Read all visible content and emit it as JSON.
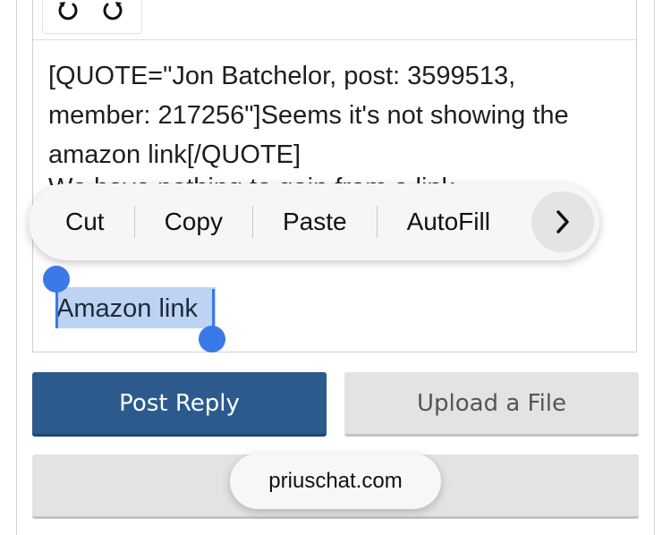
{
  "editor": {
    "toolbar": {
      "undo_icon": "undo-icon",
      "redo_icon": "redo-icon"
    },
    "lines": [
      "[QUOTE=\"Jon Batchelor, post: 3599513,",
      "member: 217256\"]Seems it's not showing the",
      "amazon link[/QUOTE]"
    ],
    "partially_hidden_line": "We have nothing to gain from a link",
    "selected_text": "Amazon link"
  },
  "context_menu": {
    "items": [
      "Cut",
      "Copy",
      "Paste",
      "AutoFill"
    ],
    "more_icon": "chevron-right-icon"
  },
  "buttons": {
    "post_reply": "Post Reply",
    "upload_file": "Upload a File"
  },
  "browser": {
    "domain": "priuschat.com"
  },
  "colors": {
    "primary": "#2c5a8d",
    "selection": "#bcd3f3",
    "handle": "#3a7ae8"
  }
}
